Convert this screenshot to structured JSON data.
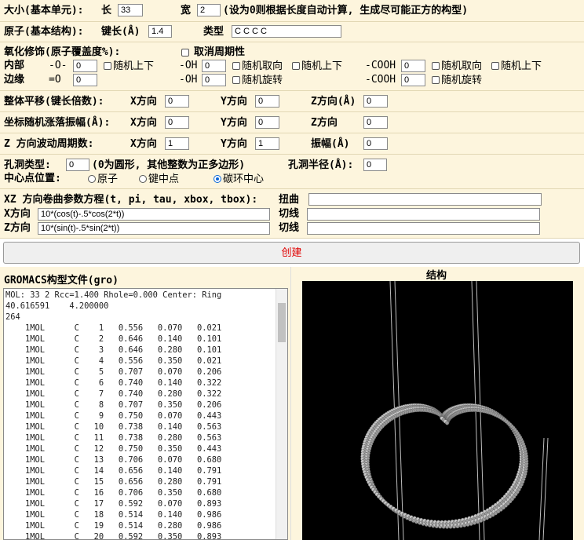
{
  "size": {
    "label": "大小(基本单元):",
    "long_label": "长",
    "long_value": "33",
    "wide_label": "宽",
    "wide_value": "2",
    "note": "(设为0则根据长度自动计算, 生成尽可能正方的构型)"
  },
  "atom": {
    "label": "原子(基本结构):",
    "bond_label": "键长(Å)",
    "bond_value": "1.4",
    "type_label": "类型",
    "type_value": "C C C C"
  },
  "oxidation": {
    "label": "氧化修饰(原子覆盖度%):",
    "cancel_period": "取消周期性",
    "inner_label": "内部",
    "edge_label": "边缘",
    "o_inner_label": "-O-",
    "o_inner_value": "0",
    "random_updown_1": "随机上下",
    "oh_inner_label": "-OH",
    "oh_inner_value": "0",
    "random_orient_1": "随机取向",
    "random_updown_2": "随机上下",
    "cooh_inner_label": "-COOH",
    "cooh_inner_value": "0",
    "random_orient_2": "随机取向",
    "random_updown_3": "随机上下",
    "o_edge_label": "=O",
    "o_edge_value": "0",
    "oh_edge_label": "-OH",
    "oh_edge_value": "0",
    "random_rotate_1": "随机旋转",
    "cooh_edge_label": "-COOH",
    "cooh_edge_value": "0",
    "random_rotate_2": "随机旋转"
  },
  "translate": {
    "label": "整体平移(键长倍数):",
    "x_label": "X方向",
    "x_value": "0",
    "y_label": "Y方向",
    "y_value": "0",
    "z_label": "Z方向(Å)",
    "z_value": "0"
  },
  "jitter": {
    "label": "坐标随机涨落振幅(Å):",
    "x_label": "X方向",
    "x_value": "0",
    "y_label": "Y方向",
    "y_value": "0",
    "z_label": "Z方向",
    "z_value": "0"
  },
  "wave": {
    "label": "Z 方向波动周期数:",
    "x_label": "X方向",
    "x_value": "1",
    "y_label": "Y方向",
    "y_value": "1",
    "amp_label": "振幅(Å)",
    "amp_value": "0"
  },
  "hole": {
    "label": "孔洞类型:",
    "type_value": "0",
    "note": "(0为圆形, 其他整数为正多边形)",
    "radius_label": "孔洞半径(Å):",
    "radius_value": "0",
    "center_label": "中心点位置:",
    "opt_atom": "原子",
    "opt_bond": "键中点",
    "opt_ring": "碳环中心"
  },
  "curl": {
    "label": "XZ 方向卷曲参数方程(t, pi, tau, xbox, tbox):",
    "twist_label": "扭曲",
    "twist_value": "",
    "x_label": "X方向",
    "x_value": "10*(cos(t)-.5*cos(2*t))",
    "z_label": "Z方向",
    "z_value": "10*(sin(t)-.5*sin(2*t))",
    "tangent_label_1": "切线",
    "tangent_value_1": "",
    "tangent_label_2": "切线",
    "tangent_value_2": ""
  },
  "create_label": "创建",
  "gro_title": "GROMACS构型文件(gro)",
  "structure_title": "结构",
  "gro_lines": [
    "MOL: 33 2 Rcc=1.400 Rhole=0.000 Center: Ring",
    "40.616591    4.200000",
    "264",
    "    1MOL      C    1   0.556   0.070   0.021",
    "    1MOL      C    2   0.646   0.140   0.101",
    "    1MOL      C    3   0.646   0.280   0.101",
    "    1MOL      C    4   0.556   0.350   0.021",
    "    1MOL      C    5   0.707   0.070   0.206",
    "    1MOL      C    6   0.740   0.140   0.322",
    "    1MOL      C    7   0.740   0.280   0.322",
    "    1MOL      C    8   0.707   0.350   0.206",
    "    1MOL      C    9   0.750   0.070   0.443",
    "    1MOL      C   10   0.738   0.140   0.563",
    "    1MOL      C   11   0.738   0.280   0.563",
    "    1MOL      C   12   0.750   0.350   0.443",
    "    1MOL      C   13   0.706   0.070   0.680",
    "    1MOL      C   14   0.656   0.140   0.791",
    "    1MOL      C   15   0.656   0.280   0.791",
    "    1MOL      C   16   0.706   0.350   0.680",
    "    1MOL      C   17   0.592   0.070   0.893",
    "    1MOL      C   18   0.514   0.140   0.986",
    "    1MOL      C   19   0.514   0.280   0.986",
    "    1MOL      C   20   0.592   0.350   0.893"
  ]
}
